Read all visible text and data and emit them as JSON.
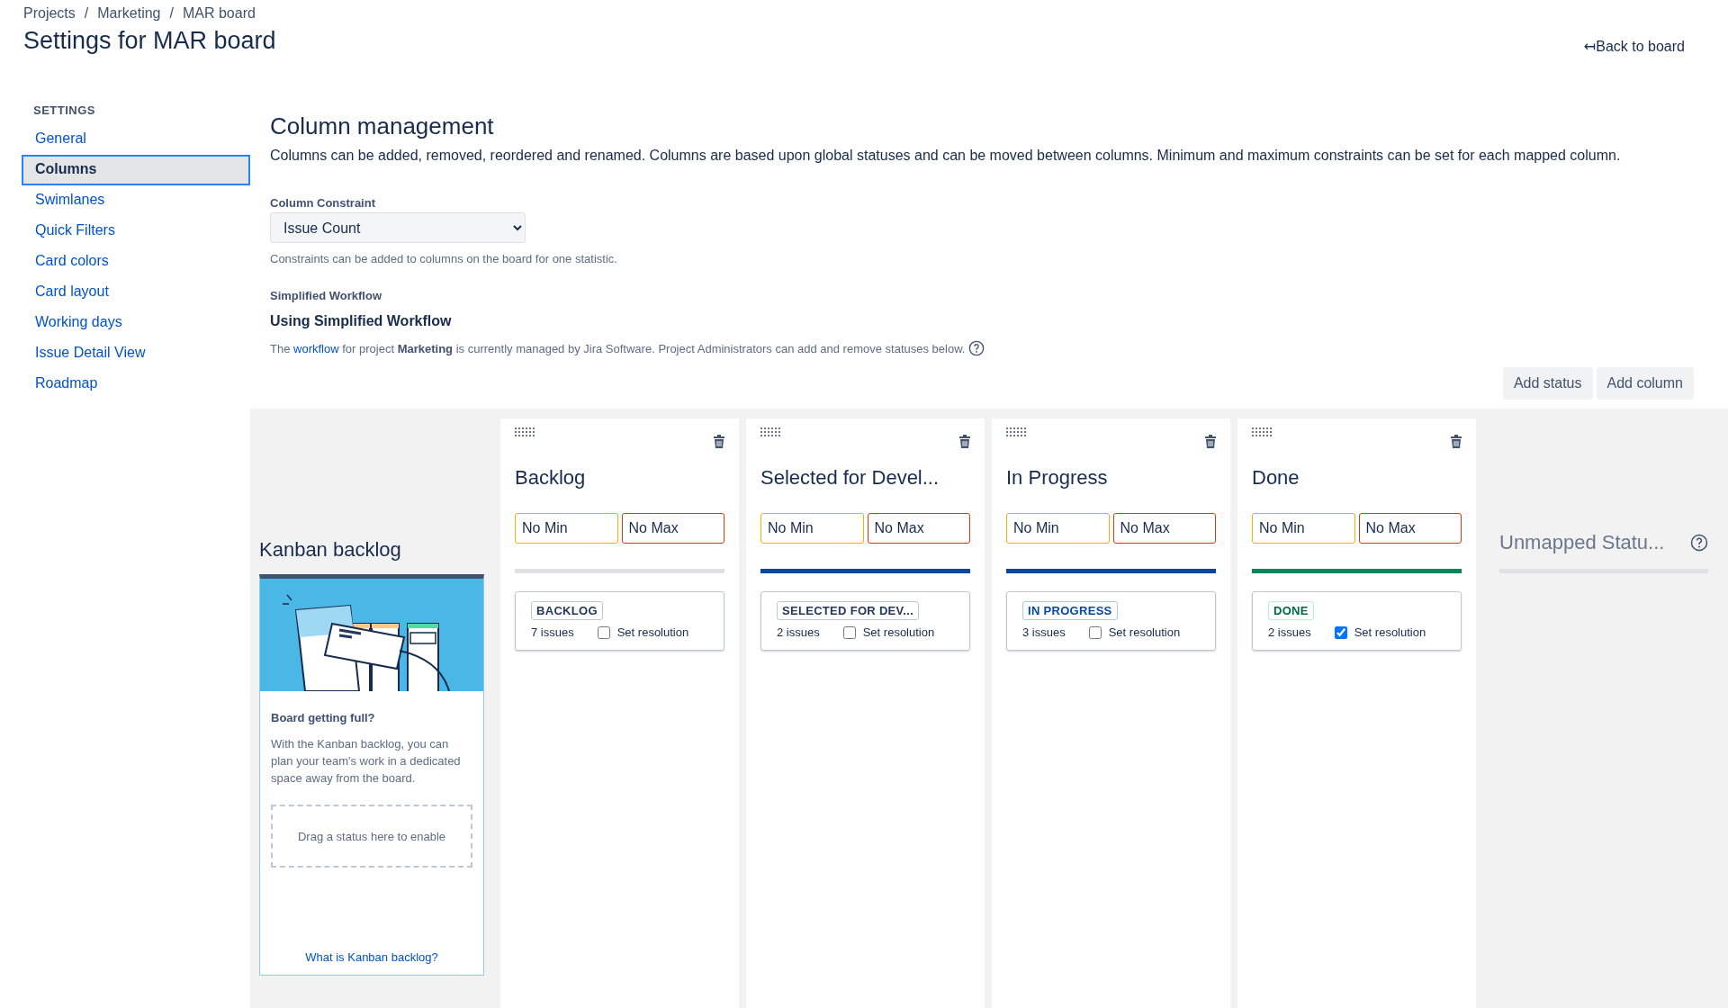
{
  "breadcrumbs": [
    "Projects",
    "Marketing",
    "MAR board"
  ],
  "breadcrumb_separator": "/",
  "title": "Settings for MAR board",
  "back_link": {
    "icon": "↤",
    "label": "Back to board"
  },
  "sidebar": {
    "heading": "SETTINGS",
    "items": [
      {
        "label": "General",
        "selected": false
      },
      {
        "label": "Columns",
        "selected": true
      },
      {
        "label": "Swimlanes",
        "selected": false
      },
      {
        "label": "Quick Filters",
        "selected": false
      },
      {
        "label": "Card colors",
        "selected": false
      },
      {
        "label": "Card layout",
        "selected": false
      },
      {
        "label": "Working days",
        "selected": false
      },
      {
        "label": "Issue Detail View",
        "selected": false
      },
      {
        "label": "Roadmap",
        "selected": false
      }
    ]
  },
  "section": {
    "title": "Column management",
    "description": "Columns can be added, removed, reordered and renamed. Columns are based upon global statuses and can be moved between columns. Minimum and maximum constraints can be set for each mapped column.",
    "constraint": {
      "label": "Column Constraint",
      "value": "Issue Count",
      "help": "Constraints can be added to columns on the board for one statistic."
    },
    "workflow": {
      "label": "Simplified Workflow",
      "heading": "Using Simplified Workflow",
      "text_before": "The",
      "link": "workflow",
      "text_middle": "for project **Marketing** is currently managed by Jira Software. Project Administrators can add and remove statuses below."
    },
    "buttons": [
      "Add status",
      "Add column"
    ]
  },
  "kanban_backlog": {
    "title": "Kanban backlog",
    "heading": "Board getting full?",
    "text": "With the Kanban backlog, you can plan your team's work in a dedicated space away from the board.",
    "drop_zone": "Drag a status here to enable",
    "link": "What is Kanban backlog?"
  },
  "columns": [
    {
      "name": "Backlog",
      "min": "No Min",
      "max": "No Max",
      "color": "#dfe1e6",
      "status": {
        "label": "BACKLOG",
        "kind": "todo"
      },
      "issues": "7 issues",
      "resolution_label": "Set resolution",
      "set_resolution": false
    },
    {
      "name": "Selected for Devel...",
      "min": "No Min",
      "max": "No Max",
      "color": "#0747a6",
      "status": {
        "label": "SELECTED FOR DEV...",
        "kind": "todo"
      },
      "issues": "2 issues",
      "resolution_label": "Set resolution",
      "set_resolution": false
    },
    {
      "name": "In Progress",
      "min": "No Min",
      "max": "No Max",
      "color": "#0747a6",
      "status": {
        "label": "IN PROGRESS",
        "kind": "inprogress"
      },
      "issues": "3 issues",
      "resolution_label": "Set resolution",
      "set_resolution": false
    },
    {
      "name": "Done",
      "min": "No Min",
      "max": "No Max",
      "color": "#00875a",
      "status": {
        "label": "DONE",
        "kind": "done"
      },
      "issues": "2 issues",
      "resolution_label": "Set resolution",
      "set_resolution": true
    }
  ],
  "unmapped": {
    "title": "Unmapped Statu..."
  }
}
